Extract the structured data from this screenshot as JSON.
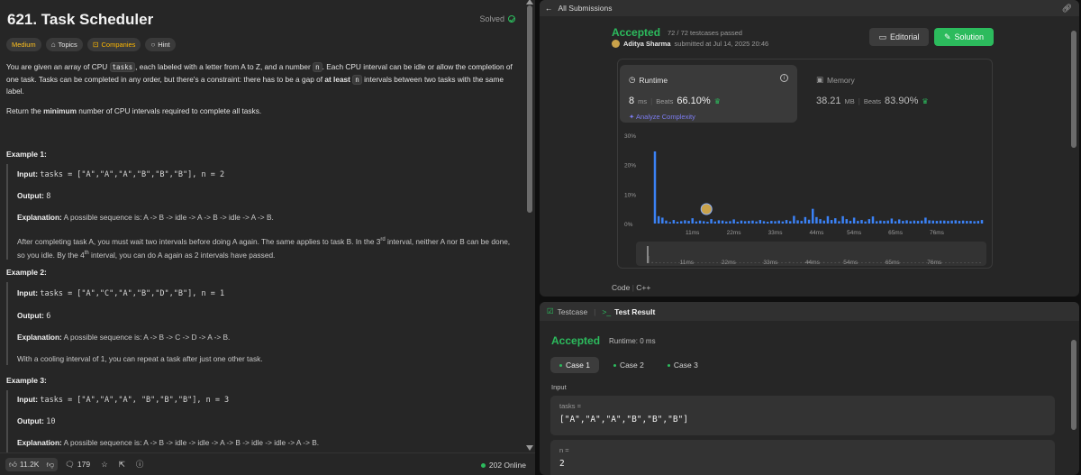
{
  "problem": {
    "title": "621. Task Scheduler",
    "solved_label": "Solved",
    "tags": [
      {
        "label": "Medium"
      },
      {
        "label": "Topics"
      },
      {
        "label": "Companies"
      },
      {
        "label": "Hint"
      }
    ],
    "desc1_a": "You are given an array of CPU ",
    "desc1_code1": "tasks",
    "desc1_b": ", each labeled with a letter from A to Z, and a number ",
    "desc1_code2": "n",
    "desc1_c": ". Each CPU interval can be idle or allow the completion of one task. Tasks can be completed in any order, but there's a constraint: there has to be a gap of ",
    "desc1_bold": "at least",
    "desc1_d": " ",
    "desc1_code3": "n",
    "desc1_e": " intervals between two tasks with the same label.",
    "desc2_a": "Return the ",
    "desc2_bold": "minimum",
    "desc2_b": " number of CPU intervals required to complete all tasks.",
    "examples": [
      {
        "title": "Example 1:",
        "input": "tasks = [\"A\",\"A\",\"A\",\"B\",\"B\",\"B\"], n = 2",
        "output": "8",
        "explanation": "A possible sequence is: A -> B -> idle -> A -> B -> idle -> A -> B.",
        "note_a": "After completing task A, you must wait two intervals before doing A again. The same applies to task B. In the 3",
        "note_sup1": "rd",
        "note_b": " interval, neither A nor B can be done, so you idle. By the 4",
        "note_sup2": "th",
        "note_c": " interval, you can do A again as 2 intervals have passed."
      },
      {
        "title": "Example 2:",
        "input": "tasks = [\"A\",\"C\",\"A\",\"B\",\"D\",\"B\"], n = 1",
        "output": "6",
        "explanation": "A possible sequence is: A -> B -> C -> D -> A -> B.",
        "note": "With a cooling interval of 1, you can repeat a task after just one other task."
      },
      {
        "title": "Example 3:",
        "input": "tasks = [\"A\",\"A\",\"A\", \"B\",\"B\",\"B\"], n = 3",
        "output": "10",
        "explanation": "A possible sequence is: A -> B -> idle -> idle -> A -> B -> idle -> idle -> A -> B."
      }
    ],
    "labels": {
      "input": "Input:",
      "output": "Output:",
      "explanation": "Explanation:"
    },
    "bottom": {
      "likes": "11.2K",
      "comments": "179",
      "online": "202 Online"
    }
  },
  "submission": {
    "header": "All Submissions",
    "status": "Accepted",
    "testcases": "72 / 72 testcases passed",
    "user": "Aditya Sharma",
    "submitted": "submitted at Jul 14, 2025 20:46",
    "editorial_label": "Editorial",
    "solution_label": "Solution",
    "runtime": {
      "label": "Runtime",
      "value": "8",
      "unit": "ms",
      "beats_label": "Beats",
      "beats": "66.10%",
      "analyze": "Analyze Complexity"
    },
    "memory": {
      "label": "Memory",
      "value": "38.21",
      "unit": "MB",
      "beats_label": "Beats",
      "beats": "83.90%"
    },
    "lang_prefix": "Code",
    "lang": "C++"
  },
  "chart_data": {
    "type": "bar",
    "title": "",
    "xlabel": "",
    "ylabel": "",
    "ylim": [
      0,
      30
    ],
    "yticks": [
      "30%",
      "20%",
      "10%",
      "0%"
    ],
    "ytick_values": [
      30,
      20,
      10,
      0
    ],
    "xticks": [
      "11ms",
      "22ms",
      "33ms",
      "44ms",
      "54ms",
      "65ms",
      "76ms"
    ],
    "x_unit": "ms",
    "x_range": [
      1,
      88
    ],
    "highlight_x": 8,
    "values": [
      24.5,
      2.5,
      2.0,
      1.0,
      0.5,
      1.2,
      0.6,
      0.8,
      1.1,
      0.9,
      1.8,
      0.7,
      1.0,
      0.8,
      0.6,
      1.5,
      0.7,
      1.1,
      1.0,
      0.7,
      0.8,
      1.4,
      0.6,
      1.0,
      0.8,
      0.9,
      1.0,
      0.7,
      1.2,
      0.8,
      0.6,
      0.9,
      0.8,
      1.0,
      0.7,
      1.2,
      0.8,
      2.6,
      1.1,
      0.9,
      2.2,
      1.3,
      5.0,
      2.2,
      1.5,
      1.0,
      2.5,
      1.2,
      1.8,
      0.8,
      2.5,
      1.5,
      0.9,
      2.0,
      0.9,
      1.2,
      0.7,
      1.5,
      2.4,
      0.8,
      1.0,
      0.9,
      1.0,
      1.7,
      0.8,
      1.4,
      0.9,
      1.1,
      0.8,
      1.0,
      0.9,
      1.0,
      2.0,
      1.1,
      1.0,
      0.9,
      1.0,
      1.0,
      0.9,
      1.0,
      1.1,
      0.9,
      1.0,
      0.9,
      0.9,
      0.8,
      0.9,
      1.2
    ],
    "range_ticks": [
      "11ms",
      "22ms",
      "33ms",
      "44ms",
      "54ms",
      "65ms",
      "76ms"
    ],
    "bar_color": "#3b82f6"
  },
  "result": {
    "tab_testcase": "Testcase",
    "tab_result": "Test Result",
    "status": "Accepted",
    "runtime": "Runtime: 0 ms",
    "cases": [
      "Case 1",
      "Case 2",
      "Case 3"
    ],
    "input_label": "Input",
    "inputs": [
      {
        "key": "tasks =",
        "value": "[\"A\",\"A\",\"A\",\"B\",\"B\",\"B\"]"
      },
      {
        "key": "n =",
        "value": "2"
      }
    ]
  }
}
